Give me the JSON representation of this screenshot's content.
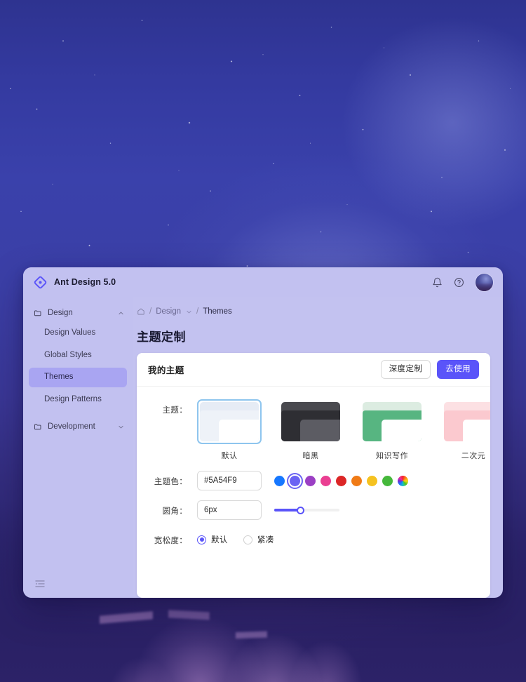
{
  "wallpaper": {
    "name": "starry-night-forest",
    "sky_color": "#3a41ab",
    "ground_color": "#2a2268"
  },
  "window": {
    "header": {
      "logo_icon": "ant-design-diamond-logo",
      "title": "Ant Design 5.0",
      "actions": [
        {
          "icon": "bell-icon",
          "name": "notifications-button"
        },
        {
          "icon": "question-circle-icon",
          "name": "help-button"
        }
      ],
      "avatar": {
        "icon": "user-avatar",
        "name": "avatar"
      }
    },
    "sidebar": {
      "groups": [
        {
          "label": "Design",
          "icon": "folder-icon",
          "caret": "chevron-up-icon",
          "expanded": true,
          "items": [
            {
              "label": "Design Values",
              "active": false
            },
            {
              "label": "Global Styles",
              "active": false
            },
            {
              "label": "Themes",
              "active": true
            },
            {
              "label": "Design Patterns",
              "active": false
            }
          ]
        },
        {
          "label": "Development",
          "icon": "folder-icon",
          "caret": "chevron-down-icon",
          "expanded": false,
          "items": []
        }
      ],
      "collapse_icon": "menu-fold-icon",
      "active_bg": "#a9a5f2"
    },
    "breadcrumb": {
      "home_icon": "home-icon",
      "separator": "/",
      "items": [
        {
          "label": "Design",
          "has_caret": true,
          "current": false
        },
        {
          "label": "Themes",
          "has_caret": false,
          "current": true
        }
      ]
    },
    "page_title": "主题定制",
    "card": {
      "title": "我的主题",
      "buttons": {
        "secondary": "深度定制",
        "primary": "去使用"
      },
      "primary_color": "#5A54F9",
      "form": {
        "theme_label": "主题：",
        "themes": [
          {
            "name": "默认",
            "selected": true,
            "outer": "#e6ecf5",
            "side": "#eef2f8",
            "main": "#ffffff"
          },
          {
            "name": "暗黑",
            "selected": false,
            "outer": "#4a4a4f",
            "side": "#2e2e33",
            "main": "#5c5c63"
          },
          {
            "name": "知识写作",
            "selected": false,
            "outer": "#dcece1",
            "side": "#57b581",
            "main": "#ffffff"
          },
          {
            "name": "二次元",
            "selected": false,
            "outer": "#fce0e3",
            "side": "#fbc9cf",
            "main": "#ffffff"
          }
        ],
        "color_label": "主题色：",
        "color_value": "#5A54F9",
        "swatches": [
          {
            "color": "#1677ff",
            "selected": false,
            "name": "blue"
          },
          {
            "color": "#6b63f3",
            "selected": true,
            "name": "indigo"
          },
          {
            "color": "#9b3fc4",
            "selected": false,
            "name": "purple"
          },
          {
            "color": "#ea3f92",
            "selected": false,
            "name": "magenta"
          },
          {
            "color": "#dc2626",
            "selected": false,
            "name": "red"
          },
          {
            "color": "#f07b16",
            "selected": false,
            "name": "orange"
          },
          {
            "color": "#f5c220",
            "selected": false,
            "name": "yellow"
          },
          {
            "color": "#45b83b",
            "selected": false,
            "name": "green"
          },
          {
            "color": "rainbow",
            "selected": false,
            "name": "custom-rainbow"
          }
        ],
        "radius_label": "圆角：",
        "radius_value": "6px",
        "radius_percent": 40,
        "density_label": "宽松度：",
        "density_options": [
          {
            "label": "默认",
            "checked": true
          },
          {
            "label": "紧凑",
            "checked": false
          }
        ]
      }
    }
  }
}
